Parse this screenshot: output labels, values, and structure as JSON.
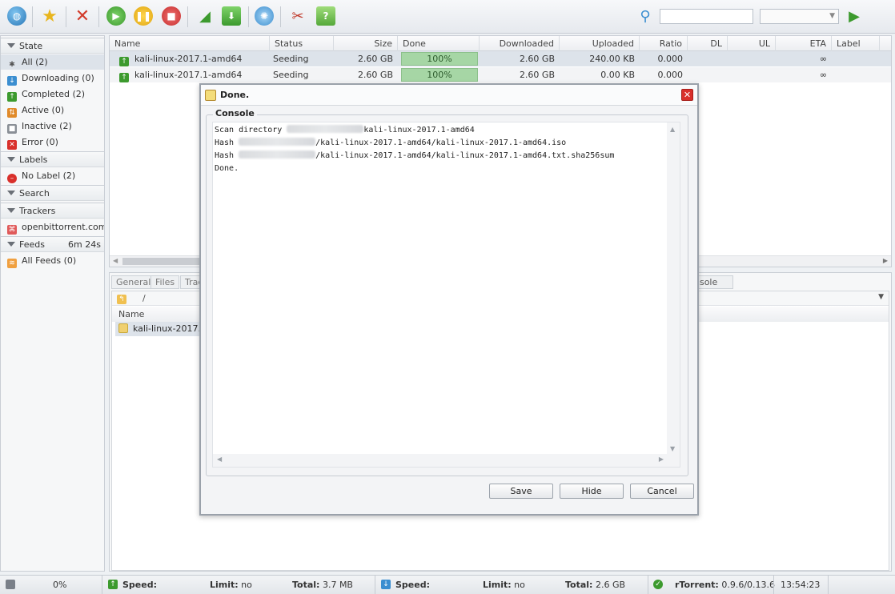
{
  "toolbar": {
    "icons": [
      "globe-icon",
      "star-icon",
      "remove-icon",
      "start-icon",
      "pause-icon",
      "stop-icon",
      "rss-icon",
      "download-icon",
      "settings-icon",
      "plugins-icon",
      "help-icon",
      "search-icon",
      "go-icon"
    ],
    "search_placeholder": "",
    "label_filter_value": ""
  },
  "sidebar": {
    "state_header": "State",
    "state_items": [
      {
        "label": "All (2)",
        "icon": "all-icon"
      },
      {
        "label": "Downloading (0)",
        "icon": "downloading-icon"
      },
      {
        "label": "Completed (2)",
        "icon": "completed-icon"
      },
      {
        "label": "Active (0)",
        "icon": "active-icon"
      },
      {
        "label": "Inactive (2)",
        "icon": "inactive-icon"
      },
      {
        "label": "Error (0)",
        "icon": "error-icon"
      }
    ],
    "labels_header": "Labels",
    "label_items": [
      {
        "label": "No Label (2)",
        "icon": "no-label-icon"
      }
    ],
    "search_header": "Search",
    "trackers_header": "Trackers",
    "tracker_items": [
      {
        "label": "openbittorrent.com (",
        "icon": "tracker-icon"
      }
    ],
    "feeds_header": "Feeds",
    "feeds_timer": "6m 24s",
    "feed_items": [
      {
        "label": "All Feeds (0)",
        "icon": "rss-feed-icon"
      }
    ]
  },
  "table": {
    "columns": [
      "Name",
      "Status",
      "Size",
      "Done",
      "Downloaded",
      "Uploaded",
      "Ratio",
      "DL",
      "UL",
      "ETA",
      "Label"
    ],
    "rows": [
      {
        "name": "kali-linux-2017.1-amd64",
        "status": "Seeding",
        "size": "2.60 GB",
        "done": "100%",
        "downloaded": "2.60 GB",
        "uploaded": "240.00 KB",
        "ratio": "0.000",
        "dl": "",
        "ul": "",
        "eta": "∞",
        "label": ""
      },
      {
        "name": "kali-linux-2017.1-amd64",
        "status": "Seeding",
        "size": "2.60 GB",
        "done": "100%",
        "downloaded": "2.60 GB",
        "uploaded": "0.00 KB",
        "ratio": "0.000",
        "dl": "",
        "ul": "",
        "eta": "∞",
        "label": ""
      }
    ]
  },
  "details": {
    "tabs": [
      "General",
      "Files",
      "Trac",
      "nsole"
    ],
    "path": "/",
    "name_header": "Name",
    "file_item": "kali-linux-2017.1-"
  },
  "status_bar": {
    "disk_percent": "0%",
    "up_speed_label": "Speed:",
    "up_limit_label": "Limit:",
    "up_limit_value": "no",
    "up_total_label": "Total:",
    "up_total_value": "3.7 MB",
    "down_speed_label": "Speed:",
    "down_limit_label": "Limit:",
    "down_limit_value": "no",
    "down_total_label": "Total:",
    "down_total_value": "2.6 GB",
    "client_label": "rTorrent:",
    "client_version": "0.9.6/0.13.6",
    "clock": "13:54:23"
  },
  "dialog": {
    "title": "Done.",
    "legend": "Console",
    "lines": [
      {
        "prefix": "Scan directory ",
        "suffix": "kali-linux-2017.1-amd64"
      },
      {
        "prefix": "Hash ",
        "suffix": "/kali-linux-2017.1-amd64/kali-linux-2017.1-amd64.iso"
      },
      {
        "prefix": "Hash ",
        "suffix": "/kali-linux-2017.1-amd64/kali-linux-2017.1-amd64.txt.sha256sum"
      },
      {
        "prefix": "Done.",
        "suffix": ""
      }
    ],
    "save_label": "Save",
    "hide_label": "Hide",
    "cancel_label": "Cancel"
  }
}
